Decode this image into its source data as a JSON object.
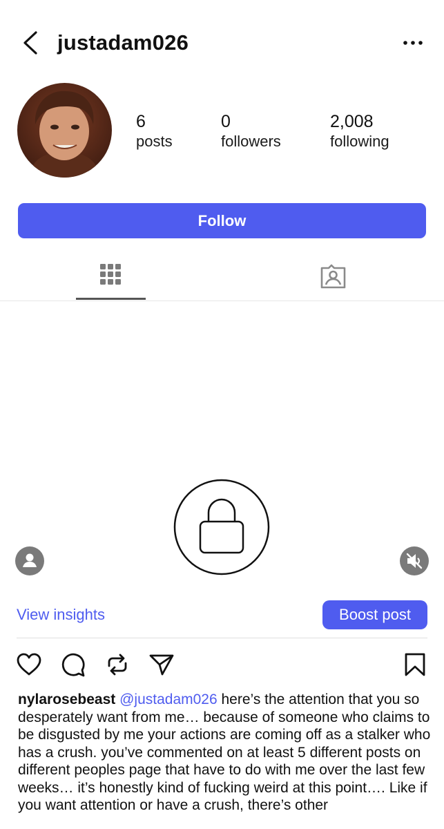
{
  "header": {
    "username": "justadam026",
    "back_icon": "chevron-left-icon",
    "more_icon": "more-horizontal-icon"
  },
  "profile": {
    "avatar_icon": "profile-photo",
    "stats": [
      {
        "value": "6",
        "label": "posts"
      },
      {
        "value": "0",
        "label": "followers"
      },
      {
        "value": "2,008",
        "label": "following"
      }
    ],
    "follow_label": "Follow"
  },
  "tabs": [
    {
      "icon": "grid-icon",
      "active": true
    },
    {
      "icon": "tagged-person-icon",
      "active": false
    }
  ],
  "post": {
    "media_icon": "lock-icon",
    "user_tag_icon": "person-icon",
    "mute_icon": "speaker-muted-icon",
    "view_insights_label": "View insights",
    "boost_label": "Boost post",
    "actions": [
      {
        "icon": "heart-icon"
      },
      {
        "icon": "comment-icon"
      },
      {
        "icon": "repost-icon"
      },
      {
        "icon": "send-icon"
      },
      {
        "icon": "bookmark-icon"
      }
    ],
    "caption": {
      "author": "nylarosebeast",
      "mention": "@justadam026",
      "text": " here’s the attention that you so desperately want from me… because of someone who claims to be disgusted by me your actions are coming off as a stalker who has a crush. you’ve commented on at least 5 different posts on different peoples page that have to do with me over the last few weeks… it’s honestly kind of fucking weird at this point…. Like if you want attention or have a crush, there’s other"
    }
  },
  "colors": {
    "accent": "#4f5cef",
    "icon_gray": "#7a7a7a"
  }
}
